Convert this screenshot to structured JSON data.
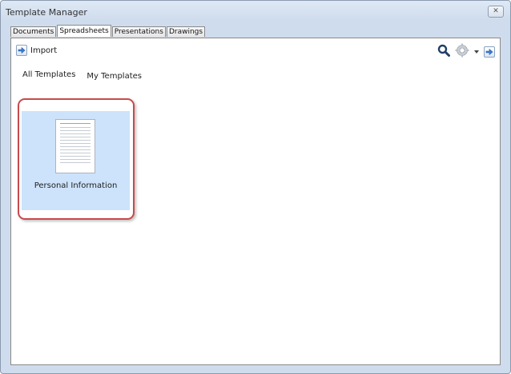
{
  "window": {
    "title": "Template Manager"
  },
  "tabs": [
    {
      "label": "Documents",
      "active": false
    },
    {
      "label": "Spreadsheets",
      "active": true
    },
    {
      "label": "Presentations",
      "active": false
    },
    {
      "label": "Drawings",
      "active": false
    }
  ],
  "toolbar": {
    "import_label": "Import",
    "icons": [
      "search-icon",
      "gear-icon",
      "dropdown-arrow-icon",
      "move-arrow-icon"
    ]
  },
  "filters": [
    "All Templates",
    "My Templates"
  ],
  "templates": [
    {
      "name": "Personal Information",
      "selected": true
    }
  ],
  "colors": {
    "selection_fill": "#cde3fb",
    "selection_border": "#c94a4a",
    "search_icon": "#1f3f66"
  }
}
